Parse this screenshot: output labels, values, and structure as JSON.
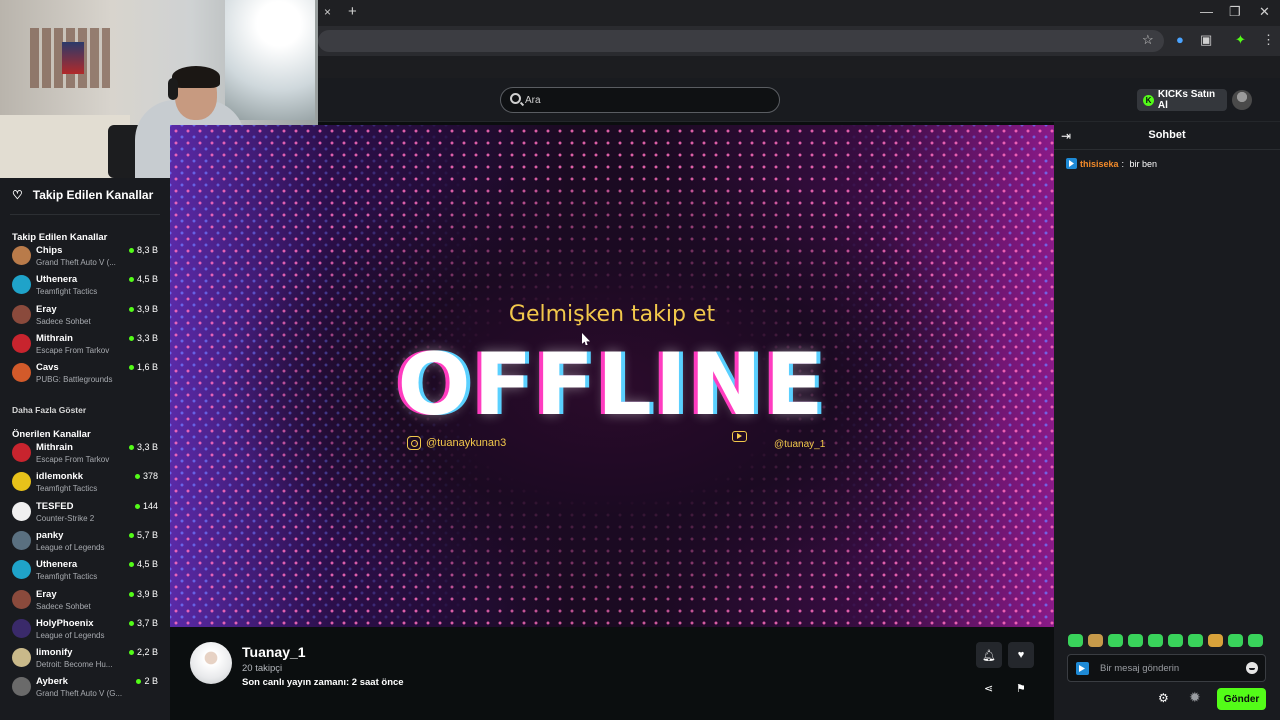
{
  "browser": {
    "tab_close": "×",
    "new_tab": "+",
    "window_controls": [
      "—",
      "❐",
      "✕"
    ]
  },
  "header": {
    "search_placeholder": "Ara",
    "kicks_label": "KICKs Satın Al",
    "kicks_icon_text": "K"
  },
  "sidebar": {
    "title": "Takip Edilen Kanallar",
    "followed_title": "Takip Edilen Kanallar",
    "followed": [
      {
        "name": "Chips",
        "game": "Grand Theft Auto V (...",
        "viewers": "8,3 B",
        "color": "#b97b4a"
      },
      {
        "name": "Uthenera",
        "game": "Teamfight Tactics",
        "viewers": "4,5 B",
        "color": "#1fa3c9"
      },
      {
        "name": "Eray",
        "game": "Sadece Sohbet",
        "viewers": "3,9 B",
        "color": "#8a4a3c"
      },
      {
        "name": "Mithrain",
        "game": "Escape From Tarkov",
        "viewers": "3,3 B",
        "color": "#c8242e"
      },
      {
        "name": "Cavs",
        "game": "PUBG: Battlegrounds",
        "viewers": "1,6 B",
        "color": "#d25a2a"
      }
    ],
    "show_more": "Daha Fazla Göster",
    "recommended_title": "Önerilen Kanallar",
    "recommended": [
      {
        "name": "Mithrain",
        "game": "Escape From Tarkov",
        "viewers": "3,3 B",
        "color": "#c8242e"
      },
      {
        "name": "idlemonkk",
        "game": "Teamfight Tactics",
        "viewers": "378",
        "color": "#e8c21a"
      },
      {
        "name": "TESFED",
        "game": "Counter-Strike 2",
        "viewers": "144",
        "color": "#f0f0f0"
      },
      {
        "name": "panky",
        "game": "League of Legends",
        "viewers": "5,7 B",
        "color": "#5a7080"
      },
      {
        "name": "Uthenera",
        "game": "Teamfight Tactics",
        "viewers": "4,5 B",
        "color": "#1fa3c9"
      },
      {
        "name": "Eray",
        "game": "Sadece Sohbet",
        "viewers": "3,9 B",
        "color": "#8a4a3c"
      },
      {
        "name": "HolyPhoenix",
        "game": "League of Legends",
        "viewers": "3,7 B",
        "color": "#3a2a6a"
      },
      {
        "name": "limonify",
        "game": "Detroit: Become Hu...",
        "viewers": "2,2 B",
        "color": "#c9b98a"
      },
      {
        "name": "Ayberk",
        "game": "Grand Theft Auto V (G...",
        "viewers": "2 B",
        "color": "#6a6a6a"
      }
    ]
  },
  "player": {
    "tagline": "Gelmişken takip et",
    "offline_text": "OFFLINE",
    "instagram": "@tuanaykunan3",
    "youtube": "@tuanay_1"
  },
  "channel": {
    "name": "Tuanay_1",
    "followers": "20 takipçi",
    "last_stream": "Son canlı yayın zamanı: 2 saat önce"
  },
  "chat": {
    "title": "Sohbet",
    "messages": [
      {
        "user": "thisiseka",
        "text": "bir ben"
      }
    ],
    "input_placeholder": "Bir mesaj gönderin",
    "send_label": "Gönder"
  },
  "colors": {
    "accent": "#53fc18",
    "background": "#0b0e0f",
    "panel": "#191b1f",
    "offline_gold": "#f2c84b"
  }
}
